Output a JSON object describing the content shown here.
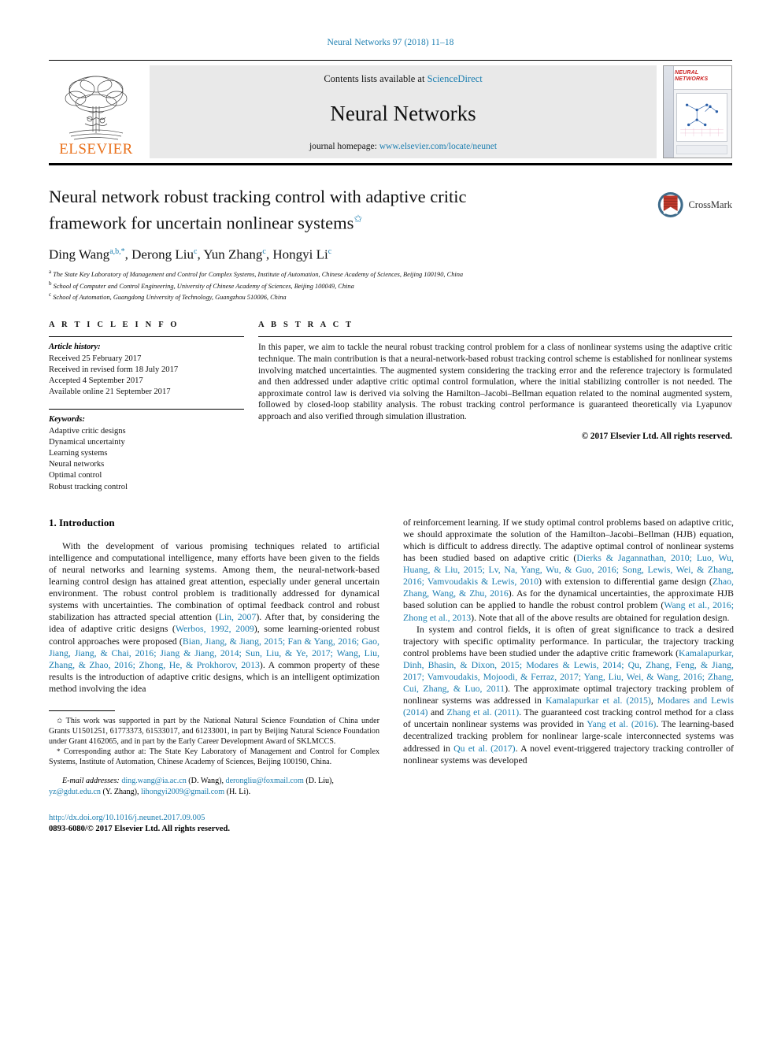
{
  "running_head": "Neural Networks 97 (2018) 11–18",
  "masthead": {
    "contents_prefix": "Contents lists available at ",
    "contents_link": "ScienceDirect",
    "journal_name": "Neural Networks",
    "homepage_prefix": "journal homepage: ",
    "homepage_url": "www.elsevier.com/locate/neunet",
    "publisher": "ELSEVIER",
    "cover_title": "NEURAL NETWORKS"
  },
  "title": {
    "line1": "Neural network robust tracking control with adaptive critic",
    "line2": "framework for uncertain nonlinear systems",
    "star": "✩"
  },
  "crossmark": {
    "label": "CrossMark"
  },
  "authors": {
    "a1_name": "Ding Wang",
    "a1_sup": "a,b,",
    "a1_ast": "*",
    "a2_name": "Derong Liu",
    "a2_sup": "c",
    "a3_name": "Yun Zhang",
    "a3_sup": "c",
    "a4_name": "Hongyi Li",
    "a4_sup": "c",
    "affiliations": [
      {
        "mark": "a",
        "text": "The State Key Laboratory of Management and Control for Complex Systems, Institute of Automation, Chinese Academy of Sciences, Beijing 100190, China"
      },
      {
        "mark": "b",
        "text": "School of Computer and Control Engineering, University of Chinese Academy of Sciences, Beijing 100049, China"
      },
      {
        "mark": "c",
        "text": "School of Automation, Guangdong University of Technology, Guangzhou 510006, China"
      }
    ]
  },
  "article_info": {
    "heading": "A R T I C L E   I N F O",
    "history_label": "Article history:",
    "history": [
      "Received 25 February 2017",
      "Received in revised form 18 July 2017",
      "Accepted 4 September 2017",
      "Available online 21 September 2017"
    ],
    "keywords_label": "Keywords:",
    "keywords": [
      "Adaptive critic designs",
      "Dynamical uncertainty",
      "Learning systems",
      "Neural networks",
      "Optimal control",
      "Robust tracking control"
    ]
  },
  "abstract": {
    "heading": "A B S T R A C T",
    "text": "In this paper, we aim to tackle the neural robust tracking control problem for a class of nonlinear systems using the adaptive critic technique. The main contribution is that a neural-network-based robust tracking control scheme is established for nonlinear systems involving matched uncertainties. The augmented system considering the tracking error and the reference trajectory is formulated and then addressed under adaptive critic optimal control formulation, where the initial stabilizing controller is not needed. The approximate control law is derived via solving the Hamilton–Jacobi–Bellman equation related to the nominal augmented system, followed by closed-loop stability analysis. The robust tracking control performance is guaranteed theoretically via Lyapunov approach and also verified through simulation illustration.",
    "copyright": "© 2017 Elsevier Ltd. All rights reserved."
  },
  "body": {
    "section_number_title": "1.  Introduction",
    "left_para_1_a": "With the development of various promising techniques related to  artificial intelligence and computational intelligence, many efforts have been given to the fields of neural networks and learning systems. Among them, the neural-network-based learning control design has attained great attention, especially under general uncertain environment. The robust control problem is traditionally addressed for dynamical systems with uncertainties. The combination of optimal feedback control and robust stabilization has attracted special attention (",
    "cit_lin": "Lin, 2007",
    "left_para_1_b": "). After that, by considering the idea of adaptive critic designs  (",
    "cit_werbos": "Werbos, 1992, 2009",
    "left_para_1_c": "), some learning-oriented robust control approaches were proposed (",
    "cit_bian": "Bian, Jiang, & Jiang, 2015",
    "sep1": "; ",
    "cit_fan": "Fan & Yang, 2016",
    "cit_gao": "Gao, Jiang, Jiang, & Chai, 2016",
    "cit_jiang": "Jiang & Jiang, 2014",
    "cit_sun": "Sun, Liu, & Ye, 2017",
    "cit_wang_liu": "Wang, Liu, Zhang, & Zhao, 2016",
    "cit_zhong_he": "Zhong, He, & Prokhorov, 2013",
    "left_para_1_d": "). A common property of these results is the introduction of adaptive critic designs, which is an intelligent optimization method involving the idea",
    "right_para_1_a": "of reinforcement learning. If we study optimal control problems based on adaptive critic, we should approximate the solution of the Hamilton–Jacobi–Bellman (HJB) equation, which is difficult to address directly. The adaptive optimal control of nonlinear systems has been studied based on adaptive critic (",
    "cit_dierks": "Dierks & Jagannathan, 2010",
    "cit_luo": "Luo, Wu, Huang, & Liu, 2015",
    "cit_lv": "Lv, Na, Yang, Wu, & Guo, 2016",
    "cit_song": "Song, Lewis, Wei, & Zhang, 2016",
    "cit_vamv_lewis": "Vamvoudakis & Lewis, 2010",
    "right_para_1_b": ") with extension to differential game design (",
    "cit_zhao": "Zhao, Zhang, Wang, & Zhu, 2016",
    "right_para_1_c": "). As for the dynamical uncertainties, the approximate HJB based solution can be applied to handle the robust control problem (",
    "cit_wang_etal": "Wang et al., 2016",
    "cit_zhong_etal": "Zhong et al., 2013",
    "right_para_1_d": "). Note that all of the above results are obtained for regulation design.",
    "right_para_2_a": "In system and control fields, it is often of great significance to track a desired trajectory with specific optimality performance. In particular, the trajectory tracking control problems have been studied under the adaptive critic framework (",
    "cit_kamalapurkar": "Kamalapurkar, Dinh, Bhasin, & Dixon, 2015",
    "cit_modares": "Modares & Lewis, 2014",
    "cit_qu": "Qu, Zhang, Feng, & Jiang, 2017",
    "cit_vamv_moj": "Vamvoudakis, Mojoodi, & Ferraz, 2017",
    "cit_yang_liu": "Yang, Liu, Wei, & Wang, 2016",
    "cit_zhang_cui": "Zhang, Cui, Zhang, & Luo, 2011",
    "right_para_2_b": "). The approximate optimal trajectory tracking problem of nonlinear systems was addressed in ",
    "cit_kamal_etal": "Kamalapurkar et al. (2015)",
    "right_para_2_c": ", ",
    "cit_modares_and_lewis": "Modares and Lewis (2014)",
    "right_para_2_d": " and ",
    "cit_zhang_etal": "Zhang et al. (2011)",
    "right_para_2_e": ". The guaranteed cost tracking control method for a class of uncertain nonlinear systems was provided in ",
    "cit_yang_etal": "Yang et al. (2016)",
    "right_para_2_f": ". The learning-based decentralized tracking problem for nonlinear large-scale interconnected systems was addressed in ",
    "cit_qu_etal": "Qu et al. (2017)",
    "right_para_2_g": ". A novel event-triggered trajectory tracking controller of nonlinear systems was developed"
  },
  "footnotes": {
    "funding_mark": "✩",
    "funding": "This work was supported in part by the National Natural Science Foundation of China under Grants U1501251, 61773373, 61533017, and 61233001, in part by Beijing Natural Science Foundation under Grant 4162065, and in part by the Early Career Development Award of SKLMCCS.",
    "corresponding_mark": "*",
    "corresponding": "Corresponding author at: The State Key Laboratory of Management and Control for Complex Systems, Institute of Automation, Chinese Academy of Sciences, Beijing 100190, China.",
    "email_label": "E-mail addresses:",
    "email1": "ding.wang@ia.ac.cn",
    "email1_who": " (D. Wang), ",
    "email2": "derongliu@foxmail.com",
    "email2_who": " (D. Liu), ",
    "email3": "yz@gdut.edu.cn",
    "email3_who": " (Y. Zhang), ",
    "email4": "lihongyi2009@gmail.com",
    "email4_who": " (H. Li).",
    "doi": "http://dx.doi.org/10.1016/j.neunet.2017.09.005",
    "issn": "0893-6080/",
    "issn_rest": "© 2017 Elsevier Ltd. All rights reserved."
  },
  "colors": {
    "link": "#1b7eb0",
    "elsevier_orange": "#E9711C",
    "band_grey": "#e9e9e9"
  }
}
